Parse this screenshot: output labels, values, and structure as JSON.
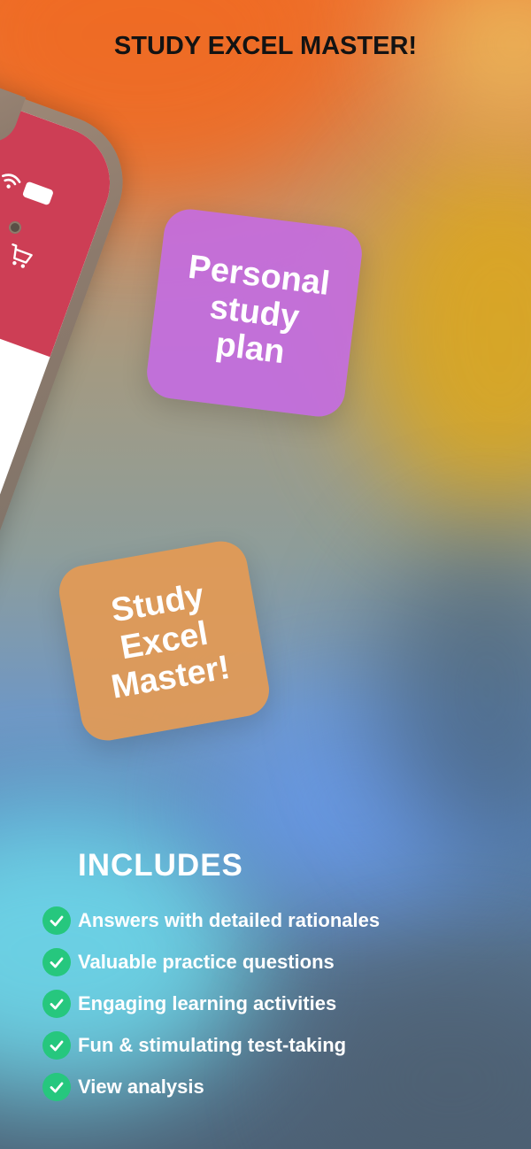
{
  "header": {
    "title": "STUDY EXCEL MASTER!"
  },
  "stickers": {
    "plan": "Personal\nstudy\nplan",
    "study": "Study\nExcel\nMaster!"
  },
  "colors": {
    "sticker_plan": "#c46ce2",
    "sticker_study": "#e49a54",
    "check": "#26c77e",
    "phone_header": "#cd3e55"
  },
  "icons": [
    "wifi-icon",
    "battery-icon",
    "cart-icon",
    "check-icon"
  ],
  "includes": {
    "title": "INCLUDES",
    "items": [
      "Answers with detailed rationales",
      "Valuable practice questions",
      "Engaging learning activities",
      "Fun & stimulating test-taking",
      "View analysis"
    ]
  }
}
